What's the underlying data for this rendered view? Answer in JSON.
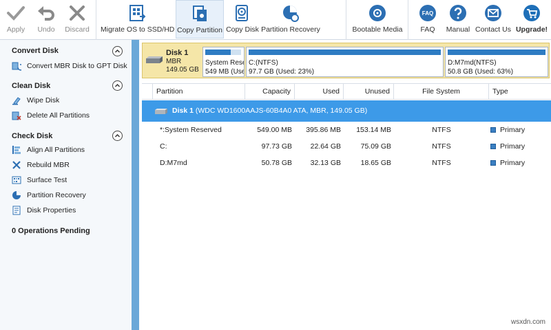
{
  "toolbar": {
    "apply": "Apply",
    "undo": "Undo",
    "discard": "Discard",
    "migrate": "Migrate OS to SSD/HD",
    "copy_partition": "Copy Partition",
    "copy_disk": "Copy Disk",
    "partition_recovery": "Partition Recovery",
    "bootable_media": "Bootable Media",
    "faq": "FAQ",
    "faq_icon_text": "FAQ",
    "manual": "Manual",
    "contact_us": "Contact Us",
    "upgrade": "Upgrade!"
  },
  "sidebar": {
    "groups": [
      {
        "title": "Convert Disk",
        "items": [
          {
            "label": "Convert MBR Disk to GPT Disk",
            "icon": "convert-disk-icon"
          }
        ]
      },
      {
        "title": "Clean Disk",
        "items": [
          {
            "label": "Wipe Disk",
            "icon": "wipe-disk-icon"
          },
          {
            "label": "Delete All Partitions",
            "icon": "delete-partitions-icon"
          }
        ]
      },
      {
        "title": "Check Disk",
        "items": [
          {
            "label": "Align All Partitions",
            "icon": "align-icon"
          },
          {
            "label": "Rebuild MBR",
            "icon": "wrench-icon"
          },
          {
            "label": "Surface Test",
            "icon": "surface-test-icon"
          },
          {
            "label": "Partition Recovery",
            "icon": "partition-recovery-icon"
          },
          {
            "label": "Disk Properties",
            "icon": "disk-properties-icon"
          }
        ]
      }
    ],
    "pending": "0 Operations Pending"
  },
  "diskmap": {
    "name": "Disk 1",
    "type": "MBR",
    "size": "149.05 GB",
    "partitions": [
      {
        "name": "System Rese",
        "info": "549 MB (Use",
        "used_fraction": 0.72
      },
      {
        "name": "C:(NTFS)",
        "info": "97.7 GB (Used: 23%)",
        "used_fraction": 1.0
      },
      {
        "name": "D:M7md(NTFS)",
        "info": "50.8 GB (Used: 63%)",
        "used_fraction": 1.0
      }
    ]
  },
  "table": {
    "headers": [
      "Partition",
      "Capacity",
      "Used",
      "Unused",
      "File System",
      "Type"
    ],
    "disk_row": {
      "name": "Disk 1",
      "detail": "(WDC WD1600AAJS-60B4A0 ATA, MBR, 149.05 GB)"
    },
    "rows": [
      {
        "partition": "*:System Reserved",
        "capacity": "549.00 MB",
        "used": "395.86 MB",
        "unused": "153.14 MB",
        "fs": "NTFS",
        "type": "Primary"
      },
      {
        "partition": "C:",
        "capacity": "97.73 GB",
        "used": "22.64 GB",
        "unused": "75.09 GB",
        "fs": "NTFS",
        "type": "Primary"
      },
      {
        "partition": "D:M7md",
        "capacity": "50.78 GB",
        "used": "32.13 GB",
        "unused": "18.65 GB",
        "fs": "NTFS",
        "type": "Primary"
      }
    ]
  },
  "watermark": "wsxdn.com",
  "colors": {
    "accent": "#3d9ae8",
    "disk_highlight": "#f5e6a8",
    "bar_fill": "#2e7cc3",
    "sidebar_scroll": "#6ba8d8",
    "upgrade_icon": "#1e6fb8"
  }
}
